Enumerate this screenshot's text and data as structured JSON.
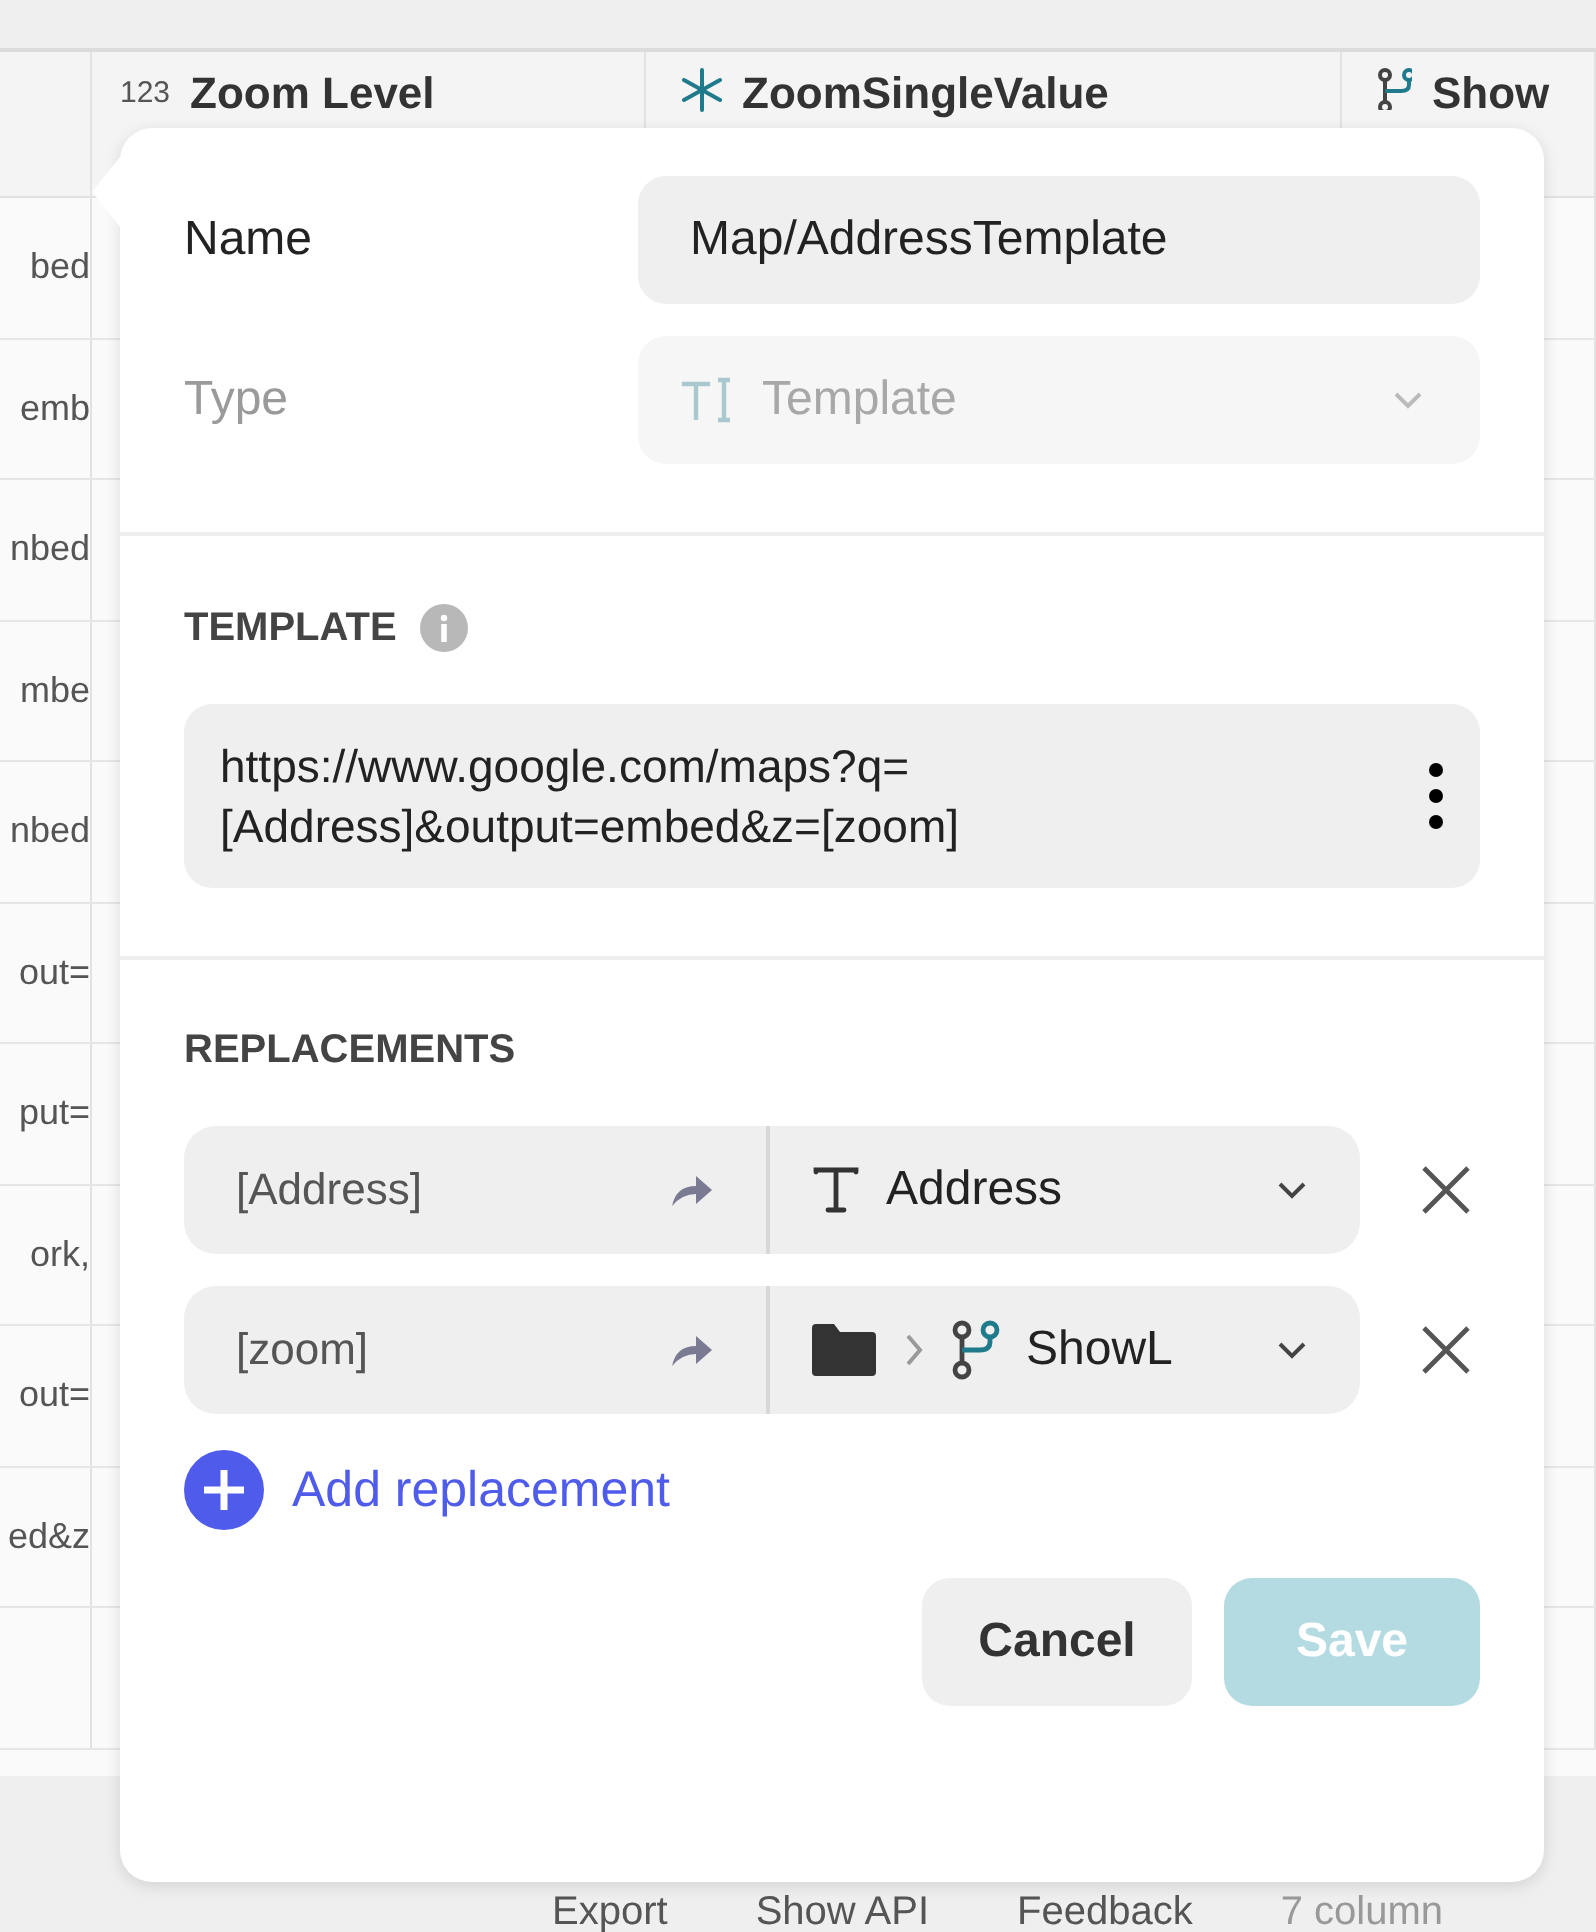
{
  "table": {
    "columns": [
      {
        "kind": "number",
        "badge": "123",
        "label": "Zoom Level"
      },
      {
        "kind": "asterisk",
        "label": "ZoomSingleValue"
      },
      {
        "kind": "branch",
        "label": "Show"
      }
    ],
    "rows": [
      "bed",
      "emb",
      "nbed",
      "mbe",
      "nbed",
      "out=",
      "put=",
      "ork,",
      "out=",
      "ed&z",
      ""
    ]
  },
  "dialog": {
    "name": {
      "label": "Name",
      "value": "Map/AddressTemplate"
    },
    "type": {
      "label": "Type",
      "value": "Template",
      "disabled": true
    },
    "template": {
      "heading": "TEMPLATE",
      "lines": [
        "https://www.google.com/maps?q=",
        "[Address]&output=embed&z=[zoom]"
      ]
    },
    "replacements": {
      "heading": "REPLACEMENTS",
      "items": [
        {
          "key": "[Address]",
          "target": {
            "kind": "text",
            "label": "Address"
          }
        },
        {
          "key": "[zoom]",
          "target": {
            "kind": "path",
            "label": "ShowL"
          }
        }
      ]
    },
    "add_label": "Add replacement",
    "buttons": [
      {
        "kind": "cancel",
        "label": "Cancel",
        "disabled": false
      },
      {
        "kind": "save",
        "label": "Save",
        "disabled": true
      }
    ]
  },
  "footer": [
    "Export",
    "Show API",
    "Feedback",
    "7 column"
  ]
}
